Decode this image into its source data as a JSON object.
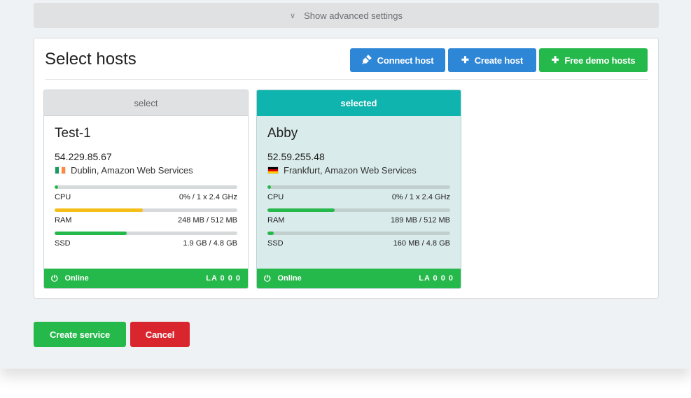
{
  "advanced": {
    "label": "Show advanced settings",
    "icon": "double-chevron-down-icon"
  },
  "panel": {
    "title": "Select hosts",
    "buttons": [
      {
        "label": "Connect host",
        "icon": "plug-icon",
        "color": "#2e86d6"
      },
      {
        "label": "Create host",
        "icon": "plus-icon",
        "color": "#2e86d6"
      },
      {
        "label": "Free demo hosts",
        "icon": "plus-icon",
        "color": "#25b84a"
      }
    ]
  },
  "hosts": [
    {
      "header": "select",
      "selected": false,
      "name": "Test-1",
      "ip": "54.229.85.67",
      "location": "Dublin, Amazon Web Services",
      "flag": "ireland-flag-icon",
      "metrics": [
        {
          "label": "CPU",
          "value": "0% / 1 x 2.4 GHz",
          "fraction": 0.0,
          "color": "#25b84a"
        },
        {
          "label": "RAM",
          "value": "248 MB / 512 MB",
          "fraction": 0.484,
          "color": "#f5bd17"
        },
        {
          "label": "SSD",
          "value": "1.9 GB / 4.8 GB",
          "fraction": 0.396,
          "color": "#25b84a"
        }
      ],
      "status": "Online",
      "load": "LA 0 0 0"
    },
    {
      "header": "selected",
      "selected": true,
      "name": "Abby",
      "ip": "52.59.255.48",
      "location": "Frankfurt, Amazon Web Services",
      "flag": "germany-flag-icon",
      "metrics": [
        {
          "label": "CPU",
          "value": "0% / 1 x 2.4 GHz",
          "fraction": 0.0,
          "color": "#25b84a"
        },
        {
          "label": "RAM",
          "value": "189 MB / 512 MB",
          "fraction": 0.369,
          "color": "#25b84a"
        },
        {
          "label": "SSD",
          "value": "160 MB / 4.8 GB",
          "fraction": 0.033,
          "color": "#25b84a"
        }
      ],
      "status": "Online",
      "load": "LA 0 0 0"
    }
  ],
  "footer": {
    "create_label": "Create service",
    "cancel_label": "Cancel"
  },
  "colors": {
    "teal": "#10b4ae",
    "green": "#25b84a",
    "blue": "#2e86d6",
    "red": "#d9262e",
    "yellow": "#f5bd17"
  }
}
